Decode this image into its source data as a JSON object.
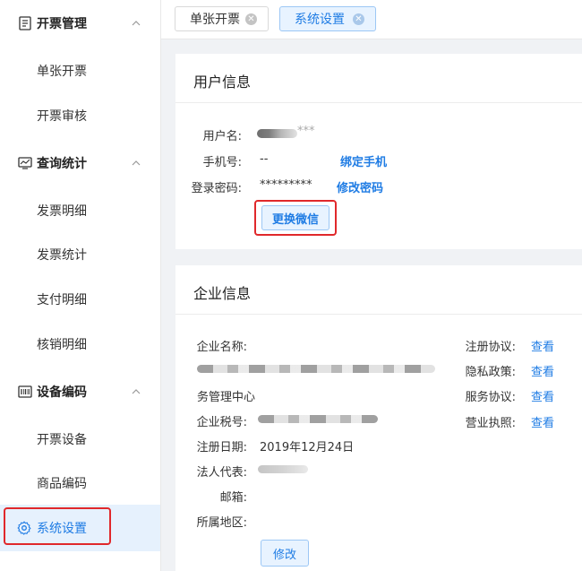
{
  "sidebar": {
    "groups": [
      {
        "label": "开票管理",
        "icon": "invoice-doc-icon",
        "items": [
          "单张开票",
          "开票审核"
        ]
      },
      {
        "label": "查询统计",
        "icon": "monitor-chart-icon",
        "items": [
          "发票明细",
          "发票统计",
          "支付明细",
          "核销明细"
        ]
      },
      {
        "label": "设备编码",
        "icon": "barcode-icon",
        "items": [
          "开票设备",
          "商品编码"
        ]
      }
    ],
    "active_item": {
      "label": "系统设置",
      "icon": "gear-icon"
    }
  },
  "tabs": [
    {
      "label": "单张开票",
      "active": false
    },
    {
      "label": "系统设置",
      "active": true
    }
  ],
  "user_info": {
    "title": "用户信息",
    "username_label": "用户名:",
    "username_visible_suffix": "***",
    "phone_label": "手机号:",
    "phone_value": "--",
    "bind_phone_link": "绑定手机",
    "password_label": "登录密码:",
    "password_value": "*********",
    "change_password_link": "修改密码",
    "change_wechat_button": "更换微信"
  },
  "company_info": {
    "title": "企业信息",
    "name_label": "企业名称:",
    "name_line2": "务管理中心",
    "tax_label": "企业税号:",
    "reg_date_label": "注册日期:",
    "reg_date_value": "2019年12月24日",
    "legal_rep_label": "法人代表:",
    "email_label": "邮箱:",
    "region_label": "所属地区:",
    "edit_button": "修改",
    "links": [
      {
        "label": "注册协议:",
        "action": "查看"
      },
      {
        "label": "隐私政策:",
        "action": "查看"
      },
      {
        "label": "服务协议:",
        "action": "查看"
      },
      {
        "label": "营业执照:",
        "action": "查看"
      }
    ]
  },
  "colors": {
    "accent": "#1f7ce4",
    "highlight": "#e0282b",
    "active_bg": "#e6f1fd"
  }
}
